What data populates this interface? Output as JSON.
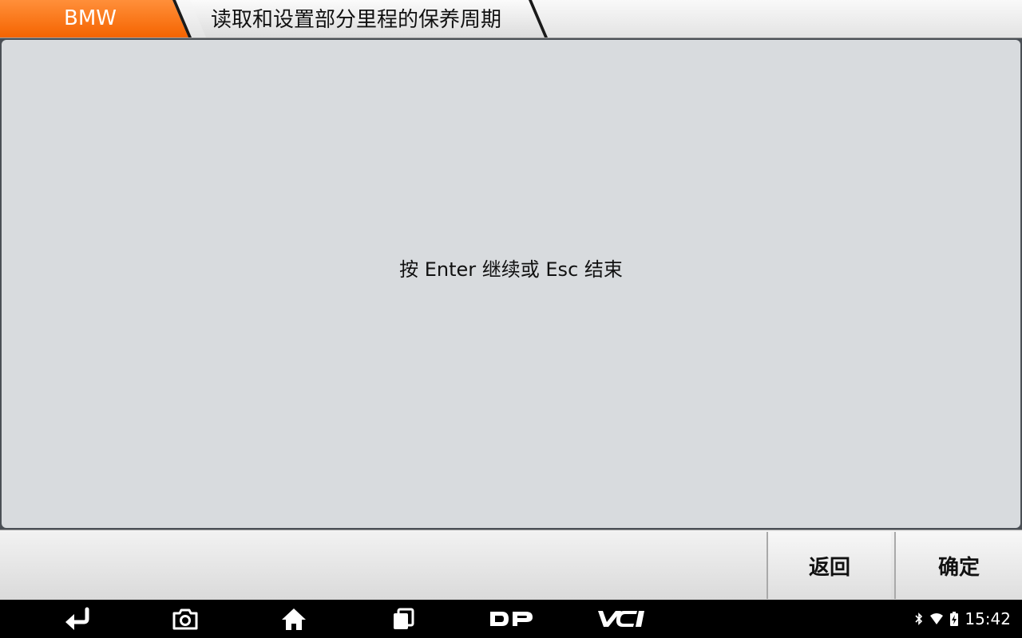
{
  "header": {
    "home_crumb": "BMW",
    "current_crumb": "读取和设置部分里程的保养周期"
  },
  "main": {
    "message": "按 Enter 继续或 Esc 结束"
  },
  "actions": {
    "back_label": "返回",
    "ok_label": "确定"
  },
  "navbar": {
    "icons": [
      "back-icon",
      "camera-icon",
      "home-icon",
      "recent-apps-icon",
      "dp-icon",
      "vci-icon"
    ],
    "dp_label": "DP",
    "vci_label": "VCI"
  },
  "status": {
    "icons": [
      "bluetooth-icon",
      "wifi-icon",
      "battery-charging-icon"
    ],
    "time": "15:42"
  },
  "colors": {
    "accent": "#f56400",
    "panel": "#d8dbde",
    "navbar": "#000000"
  }
}
